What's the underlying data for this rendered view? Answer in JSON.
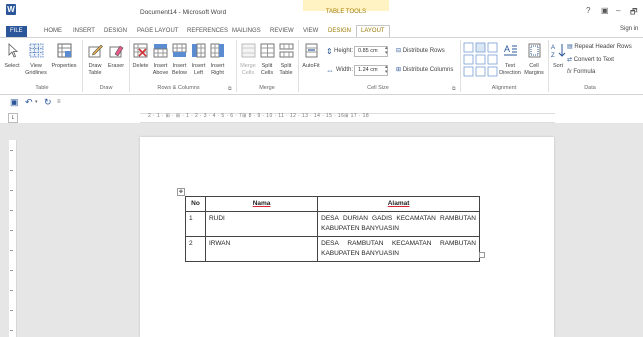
{
  "window": {
    "title": "Document14 - Microsoft Word",
    "context_title": "TABLE TOOLS",
    "controls": [
      "?",
      "▣",
      "–",
      "🗗"
    ],
    "signin": "Sign in"
  },
  "tabs": [
    "FILE",
    "HOME",
    "INSERT",
    "DESIGN",
    "PAGE LAYOUT",
    "REFERENCES",
    "MAILINGS",
    "REVIEW",
    "VIEW",
    "DESIGN",
    "LAYOUT"
  ],
  "ribbon": {
    "table": {
      "select": "Select",
      "view_gridlines": "View Gridlines",
      "properties": "Properties",
      "label": "Table"
    },
    "draw": {
      "draw_table": "Draw Table",
      "eraser": "Eraser",
      "label": "Draw"
    },
    "rows_columns": {
      "delete": "Delete",
      "insert_above": "Insert Above",
      "insert_below": "Insert Below",
      "insert_left": "Insert Left",
      "insert_right": "Insert Right",
      "label": "Rows & Columns"
    },
    "merge": {
      "merge_cells": "Merge Cells",
      "split_cells": "Split Cells",
      "split_table": "Split Table",
      "label": "Merge"
    },
    "cell_size": {
      "autofit": "AutoFit",
      "height_label": "Height:",
      "height_value": "0.85 cm",
      "width_label": "Width:",
      "width_value": "1.24 cm",
      "distribute_rows": "Distribute Rows",
      "distribute_columns": "Distribute Columns",
      "label": "Cell Size"
    },
    "alignment": {
      "text_direction": "Text Direction",
      "cell_margins": "Cell Margins",
      "label": "Alignment"
    },
    "data": {
      "sort": "Sort",
      "repeat_header_rows": "Repeat Header Rows",
      "convert_to_text": "Convert to Text",
      "formula": "Formula",
      "label": "Data"
    }
  },
  "ruler": "2 · 1 · ⊞ · ⊞ · 1 · 2 · 3 · 4 · 5 · 6 · 7⊞ 8 · 9 · 10 · 11 · 12 · 13 · 14 · 15 · 16⊞ 17 · 18",
  "document": {
    "headers": [
      "No",
      "Nama",
      "Alamat"
    ],
    "rows": [
      {
        "no": "1",
        "nama": "RUDI",
        "alamat_words": [
          "DESA",
          "DURIAN",
          "GADIS",
          "KECAMATAN",
          "RAMBUTAN"
        ],
        "alamat_line2": "KABUPATEN BANYUASIN"
      },
      {
        "no": "2",
        "nama": "IRWAN",
        "alamat_words": [
          "DESA",
          "RAMBUTAN",
          "KECAMATAN",
          "RAMBUTAN"
        ],
        "alamat_line2": "KABUPATEN BANYUASIN"
      }
    ]
  }
}
